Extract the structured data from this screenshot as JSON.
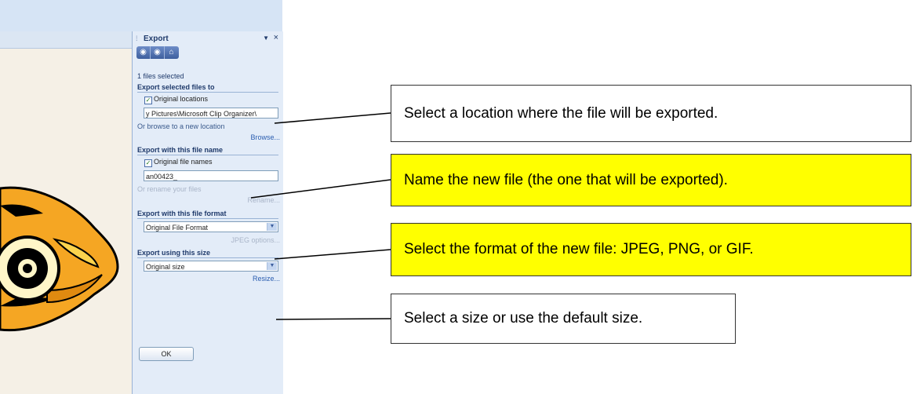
{
  "panel": {
    "title": "Export",
    "dropdown_icon": "▼",
    "close_icon": "×",
    "nav": [
      "◉",
      "◉",
      "⌂"
    ],
    "files_selected": "1 files selected",
    "sections": {
      "location": {
        "header": "Export selected files to",
        "checkbox_label": "Original locations",
        "path_value": "y Pictures\\Microsoft Clip Organizer\\",
        "hint": "Or browse to a new location",
        "link": "Browse..."
      },
      "name": {
        "header": "Export with this file name",
        "checkbox_label": "Original file names",
        "name_value": "an00423_",
        "hint": "Or rename your files",
        "link": "Rename..."
      },
      "format": {
        "header": "Export with this file format",
        "selected": "Original File Format",
        "link": "JPEG options..."
      },
      "size": {
        "header": "Export using this size",
        "selected": "Original size",
        "link": "Resize..."
      }
    },
    "ok_label": "OK"
  },
  "callouts": [
    {
      "text": "Select a location where the file will be exported.",
      "highlight": false
    },
    {
      "text": "Name the new file (the one that will be exported).",
      "highlight": true
    },
    {
      "text": "Select the format of the new file: JPEG, PNG, or GIF.",
      "highlight": true
    },
    {
      "text": "Select a size or use the default size.",
      "highlight": false
    }
  ],
  "colors": {
    "panel_bg": "#e3ecf8",
    "header_text": "#1f3a6b",
    "link": "#2a5db0",
    "highlight": "#ffff00"
  }
}
